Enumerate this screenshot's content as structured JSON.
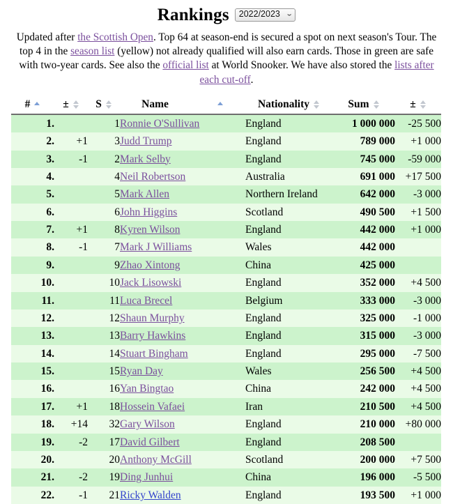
{
  "header": {
    "title": "Rankings",
    "season_selected": "2022/2023",
    "season_options": [
      "2022/2023"
    ],
    "chevron": "⌄"
  },
  "intro": {
    "part1": "Updated after ",
    "link_event": "the Scottish Open",
    "part2": ". Top 64 at season-end is secured a spot on next season's Tour. The top 4 in the ",
    "link_season_list": "season list",
    "part3": " (yellow) not already qualified will also earn cards. Those in green are safe with two-year cards. See also the ",
    "link_official_list": "official list",
    "part4": " at World Snooker. We have also stored the ",
    "link_cutoff": "lists after each cut-off",
    "part5": "."
  },
  "table": {
    "columns": [
      {
        "key": "rank",
        "label": "#",
        "sort": "asc"
      },
      {
        "key": "delta",
        "label": "±",
        "sort": "none"
      },
      {
        "key": "seed",
        "label": "S",
        "sort": "none"
      },
      {
        "key": "name",
        "label": "Name",
        "sort": "asc"
      },
      {
        "key": "nat",
        "label": "Nationality",
        "sort": "none"
      },
      {
        "key": "sum",
        "label": "Sum",
        "sort": "none"
      },
      {
        "key": "pm",
        "label": "±",
        "sort": "none"
      }
    ],
    "rows": [
      {
        "rank": "1.",
        "delta": "",
        "seed": "1",
        "name": "Ronnie O'Sullivan",
        "visited": true,
        "nat": "England",
        "sum": "1 000 000",
        "pm": "-25 500"
      },
      {
        "rank": "2.",
        "delta": "+1",
        "seed": "3",
        "name": "Judd Trump",
        "visited": true,
        "nat": "England",
        "sum": "789 000",
        "pm": "+1 000"
      },
      {
        "rank": "3.",
        "delta": "-1",
        "seed": "2",
        "name": "Mark Selby",
        "visited": true,
        "nat": "England",
        "sum": "745 000",
        "pm": "-59 000"
      },
      {
        "rank": "4.",
        "delta": "",
        "seed": "4",
        "name": "Neil Robertson",
        "visited": true,
        "nat": "Australia",
        "sum": "691 000",
        "pm": "+17 500"
      },
      {
        "rank": "5.",
        "delta": "",
        "seed": "5",
        "name": "Mark Allen",
        "visited": true,
        "nat": "Northern Ireland",
        "sum": "642 000",
        "pm": "-3 000"
      },
      {
        "rank": "6.",
        "delta": "",
        "seed": "6",
        "name": "John Higgins",
        "visited": true,
        "nat": "Scotland",
        "sum": "490 500",
        "pm": "+1 500"
      },
      {
        "rank": "7.",
        "delta": "+1",
        "seed": "8",
        "name": "Kyren Wilson",
        "visited": true,
        "nat": "England",
        "sum": "442 000",
        "pm": "+1 000"
      },
      {
        "rank": "8.",
        "delta": "-1",
        "seed": "7",
        "name": "Mark J Williams",
        "visited": true,
        "nat": "Wales",
        "sum": "442 000",
        "pm": ""
      },
      {
        "rank": "9.",
        "delta": "",
        "seed": "9",
        "name": "Zhao Xintong",
        "visited": true,
        "nat": "China",
        "sum": "425 000",
        "pm": ""
      },
      {
        "rank": "10.",
        "delta": "",
        "seed": "10",
        "name": "Jack Lisowski",
        "visited": true,
        "nat": "England",
        "sum": "352 000",
        "pm": "+4 500"
      },
      {
        "rank": "11.",
        "delta": "",
        "seed": "11",
        "name": "Luca Brecel",
        "visited": true,
        "nat": "Belgium",
        "sum": "333 000",
        "pm": "-3 000"
      },
      {
        "rank": "12.",
        "delta": "",
        "seed": "12",
        "name": "Shaun Murphy",
        "visited": true,
        "nat": "England",
        "sum": "325 000",
        "pm": "-1 000"
      },
      {
        "rank": "13.",
        "delta": "",
        "seed": "13",
        "name": "Barry Hawkins",
        "visited": true,
        "nat": "England",
        "sum": "315 000",
        "pm": "-3 000"
      },
      {
        "rank": "14.",
        "delta": "",
        "seed": "14",
        "name": "Stuart Bingham",
        "visited": true,
        "nat": "England",
        "sum": "295 000",
        "pm": "-7 500"
      },
      {
        "rank": "15.",
        "delta": "",
        "seed": "15",
        "name": "Ryan Day",
        "visited": true,
        "nat": "Wales",
        "sum": "256 500",
        "pm": "+4 500"
      },
      {
        "rank": "16.",
        "delta": "",
        "seed": "16",
        "name": "Yan Bingtao",
        "visited": true,
        "nat": "China",
        "sum": "242 000",
        "pm": "+4 500"
      },
      {
        "rank": "17.",
        "delta": "+1",
        "seed": "18",
        "name": "Hossein Vafaei",
        "visited": true,
        "nat": "Iran",
        "sum": "210 500",
        "pm": "+4 500"
      },
      {
        "rank": "18.",
        "delta": "+14",
        "seed": "32",
        "name": "Gary Wilson",
        "visited": true,
        "nat": "England",
        "sum": "210 000",
        "pm": "+80 000"
      },
      {
        "rank": "19.",
        "delta": "-2",
        "seed": "17",
        "name": "David Gilbert",
        "visited": true,
        "nat": "England",
        "sum": "208 500",
        "pm": ""
      },
      {
        "rank": "20.",
        "delta": "",
        "seed": "20",
        "name": "Anthony McGill",
        "visited": true,
        "nat": "Scotland",
        "sum": "200 000",
        "pm": "+7 500"
      },
      {
        "rank": "21.",
        "delta": "-2",
        "seed": "19",
        "name": "Ding Junhui",
        "visited": true,
        "nat": "China",
        "sum": "196 000",
        "pm": "-5 500"
      },
      {
        "rank": "22.",
        "delta": "-1",
        "seed": "21",
        "name": "Ricky Walden",
        "visited": false,
        "nat": "England",
        "sum": "193 500",
        "pm": "+1 000"
      }
    ]
  },
  "colors": {
    "row_odd": "#ccf3cc",
    "row_even": "#eafbe7",
    "link_visited": "#7b4f9d",
    "link_unvisited": "#3344cc",
    "sort_active": "#7d9fd6",
    "sort_inactive": "#c2c7cf"
  }
}
